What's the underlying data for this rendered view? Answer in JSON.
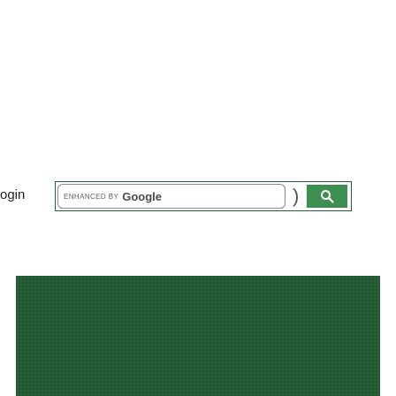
{
  "header": {
    "login_label": "ogin"
  },
  "search": {
    "enhanced_label": "ENHANCED BY",
    "brand_label": "Google",
    "value": "",
    "placeholder": ""
  },
  "colors": {
    "accent_green": "#3e8f52",
    "panel_green": "#245a33",
    "border_green": "#245f34"
  },
  "icons": {
    "search_button_icon": "search-icon"
  }
}
